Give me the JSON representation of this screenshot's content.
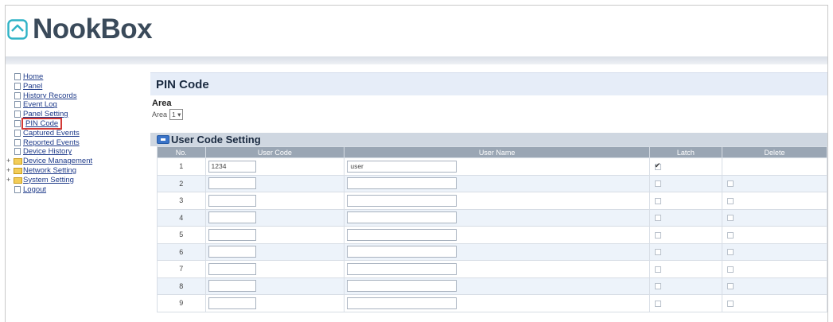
{
  "brand": {
    "name": "NookBox",
    "icon": "nookbox-logo-icon"
  },
  "sidebar": {
    "items": [
      {
        "label": "Home",
        "icon": "page-icon"
      },
      {
        "label": "Panel",
        "icon": "page-icon"
      },
      {
        "label": "History Records",
        "icon": "page-icon"
      },
      {
        "label": "Event Log",
        "icon": "page-icon"
      },
      {
        "label": "Panel Setting",
        "icon": "page-icon"
      },
      {
        "label": "PIN Code",
        "icon": "page-icon",
        "selected": true
      },
      {
        "label": "Captured Events",
        "icon": "page-icon"
      },
      {
        "label": "Reported Events",
        "icon": "page-icon"
      },
      {
        "label": "Device History",
        "icon": "page-icon"
      },
      {
        "label": "Device Management",
        "icon": "folder-icon",
        "expander": "+"
      },
      {
        "label": "Network Setting",
        "icon": "folder-icon",
        "expander": "+"
      },
      {
        "label": "System Setting",
        "icon": "folder-icon",
        "expander": "+"
      },
      {
        "label": "Logout",
        "icon": "page-icon"
      }
    ]
  },
  "main": {
    "title": "PIN Code",
    "area": {
      "heading": "Area",
      "label": "Area",
      "selected": "1"
    },
    "section": {
      "title": "User Code Setting",
      "icon": "collapse-icon"
    },
    "table": {
      "headers": {
        "no": "No.",
        "user_code": "User Code",
        "user_name": "User Name",
        "latch": "Latch",
        "delete": "Delete"
      },
      "rows": [
        {
          "no": "1",
          "code": "1234",
          "name": "user",
          "latch": true,
          "delete": false,
          "delete_visible": false
        },
        {
          "no": "2",
          "code": "",
          "name": "",
          "latch": false,
          "delete": false,
          "delete_visible": true
        },
        {
          "no": "3",
          "code": "",
          "name": "",
          "latch": false,
          "delete": false,
          "delete_visible": true
        },
        {
          "no": "4",
          "code": "",
          "name": "",
          "latch": false,
          "delete": false,
          "delete_visible": true
        },
        {
          "no": "5",
          "code": "",
          "name": "",
          "latch": false,
          "delete": false,
          "delete_visible": true
        },
        {
          "no": "6",
          "code": "",
          "name": "",
          "latch": false,
          "delete": false,
          "delete_visible": true
        },
        {
          "no": "7",
          "code": "",
          "name": "",
          "latch": false,
          "delete": false,
          "delete_visible": true
        },
        {
          "no": "8",
          "code": "",
          "name": "",
          "latch": false,
          "delete": false,
          "delete_visible": true
        },
        {
          "no": "9",
          "code": "",
          "name": "",
          "latch": false,
          "delete": false,
          "delete_visible": true
        }
      ]
    }
  },
  "colors": {
    "accent": "#3a73c8",
    "header_bg": "#e6edf8",
    "selected_outline": "#d23a36"
  }
}
